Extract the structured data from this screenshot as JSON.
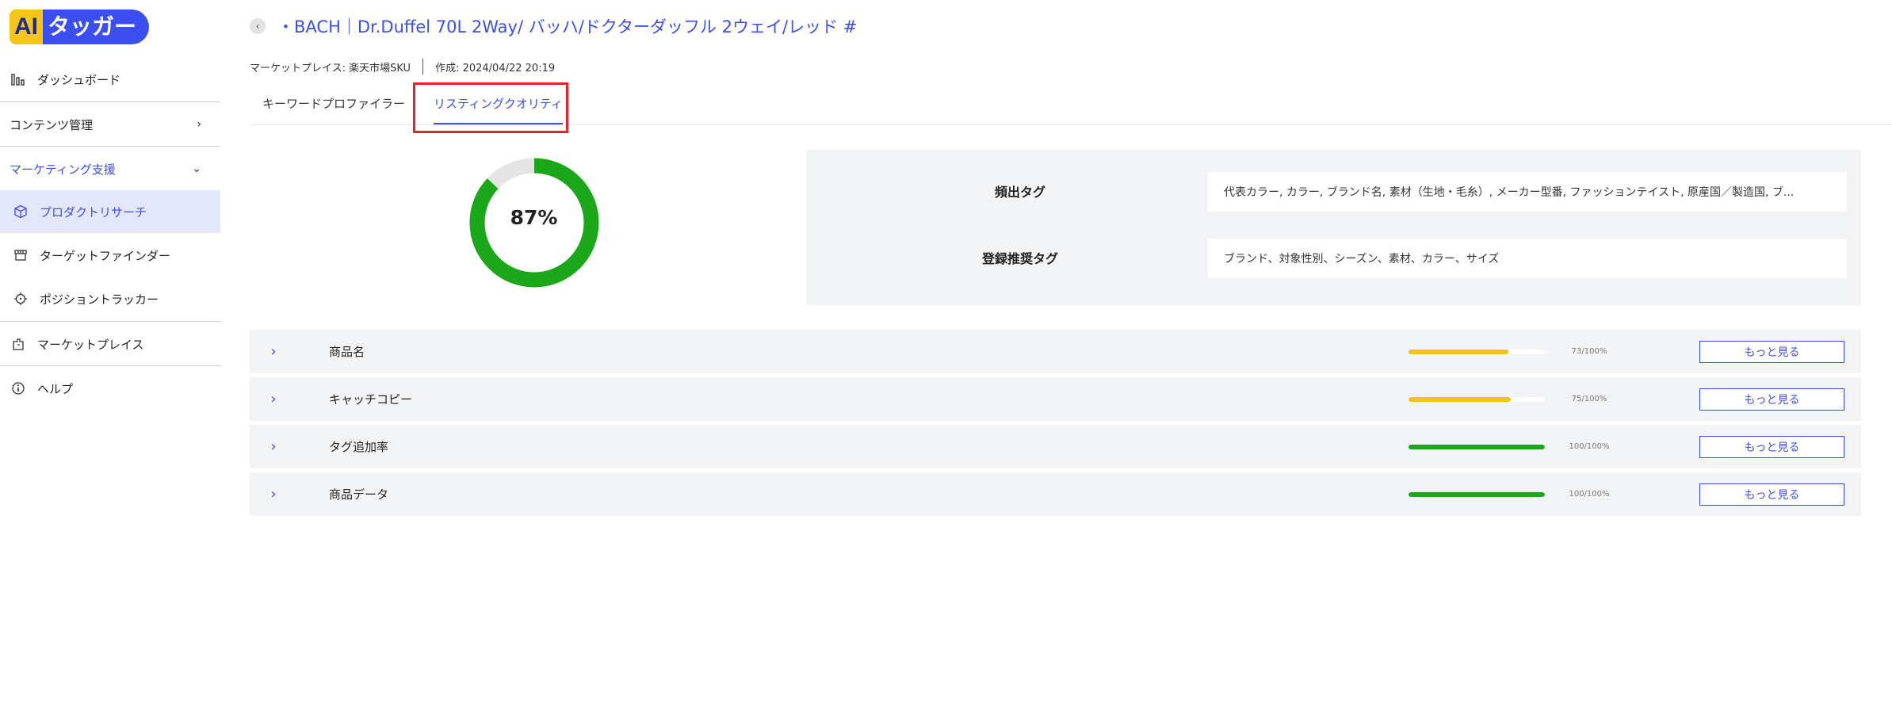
{
  "app": {
    "logo_ai": "AI",
    "logo_text": "タッガー"
  },
  "sidebar": {
    "dashboard": "ダッシュボード",
    "content_mgmt": "コンテンツ管理",
    "marketing": "マーケティング支援",
    "product_research": "プロダクトリサーチ",
    "target_finder": "ターゲットファインダー",
    "position_tracker": "ポジショントラッカー",
    "marketplace": "マーケットプレイス",
    "help": "ヘルプ"
  },
  "header": {
    "title": "・BACH｜Dr.Duffel 70L 2Way/ バッハ/ドクターダッフル 2ウェイ/レッド #",
    "marketplace": "マーケットプレイス: 楽天市場SKU",
    "created": "作成: 2024/04/22 20:19"
  },
  "tabs": [
    {
      "label": "キーワードプロファイラー"
    },
    {
      "label": "リスティングクオリティ"
    }
  ],
  "score": {
    "value": 87,
    "label": "87%"
  },
  "tags": {
    "frequent_label": "頻出タグ",
    "frequent_value": "代表カラー, カラー, ブランド名, 素材（生地・毛糸）, メーカー型番, ファッションテイスト, 原産国／製造国, ブ...",
    "recommended_label": "登録推奨タグ",
    "recommended_value": "ブランド、対象性別、シーズン、素材、カラー、サイズ"
  },
  "rows": [
    {
      "label": "商品名",
      "score_text": "73/100%",
      "progress": 73,
      "color": "#f2c31b",
      "button": "もっと見る"
    },
    {
      "label": "キャッチコピー",
      "score_text": "75/100%",
      "progress": 75,
      "color": "#f2c31b",
      "button": "もっと見る"
    },
    {
      "label": "タグ追加率",
      "score_text": "100/100%",
      "progress": 100,
      "color": "#1aa81a",
      "button": "もっと見る"
    },
    {
      "label": "商品データ",
      "score_text": "100/100%",
      "progress": 100,
      "color": "#1aa81a",
      "button": "もっと見る"
    }
  ],
  "colors": {
    "accent": "#3b4ef0",
    "good": "#1aa81a",
    "warn": "#f2c31b",
    "highlight": "#e8232c"
  }
}
